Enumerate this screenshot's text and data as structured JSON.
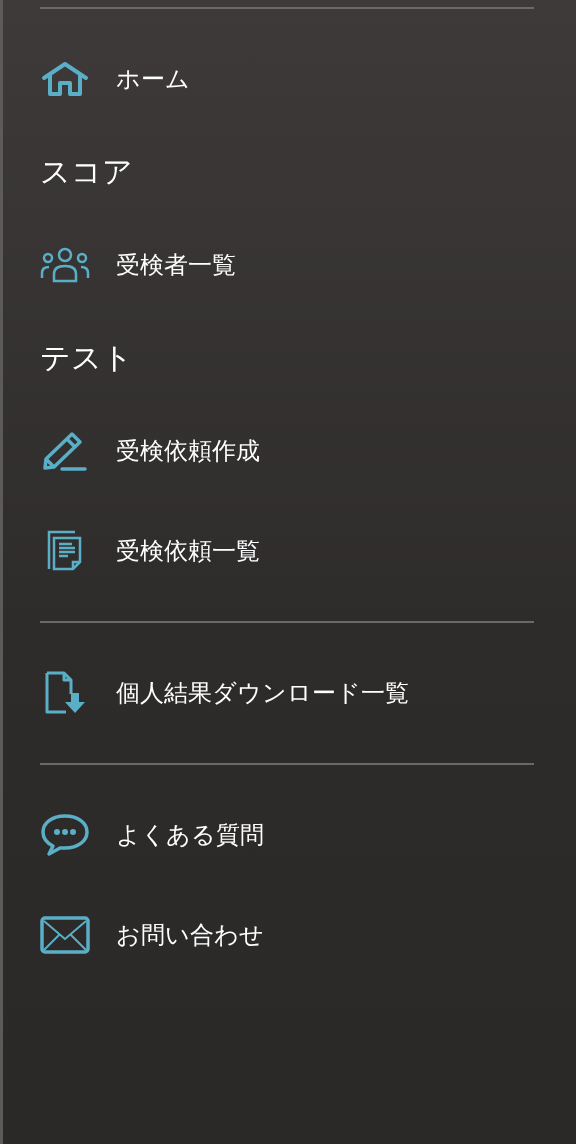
{
  "menu": [
    {
      "kind": "divider"
    },
    {
      "kind": "item",
      "label": "ホーム"
    },
    {
      "kind": "heading",
      "label": "スコア"
    },
    {
      "kind": "item",
      "label": "受検者一覧"
    },
    {
      "kind": "heading",
      "label": "テスト"
    },
    {
      "kind": "item",
      "label": "受検依頼作成"
    },
    {
      "kind": "item",
      "label": "受検依頼一覧"
    },
    {
      "kind": "divider"
    },
    {
      "kind": "item",
      "label": "個人結果ダウンロード一覧"
    },
    {
      "kind": "divider"
    },
    {
      "kind": "item",
      "label": "よくある質問"
    },
    {
      "kind": "item",
      "label": "お問い合わせ"
    }
  ]
}
